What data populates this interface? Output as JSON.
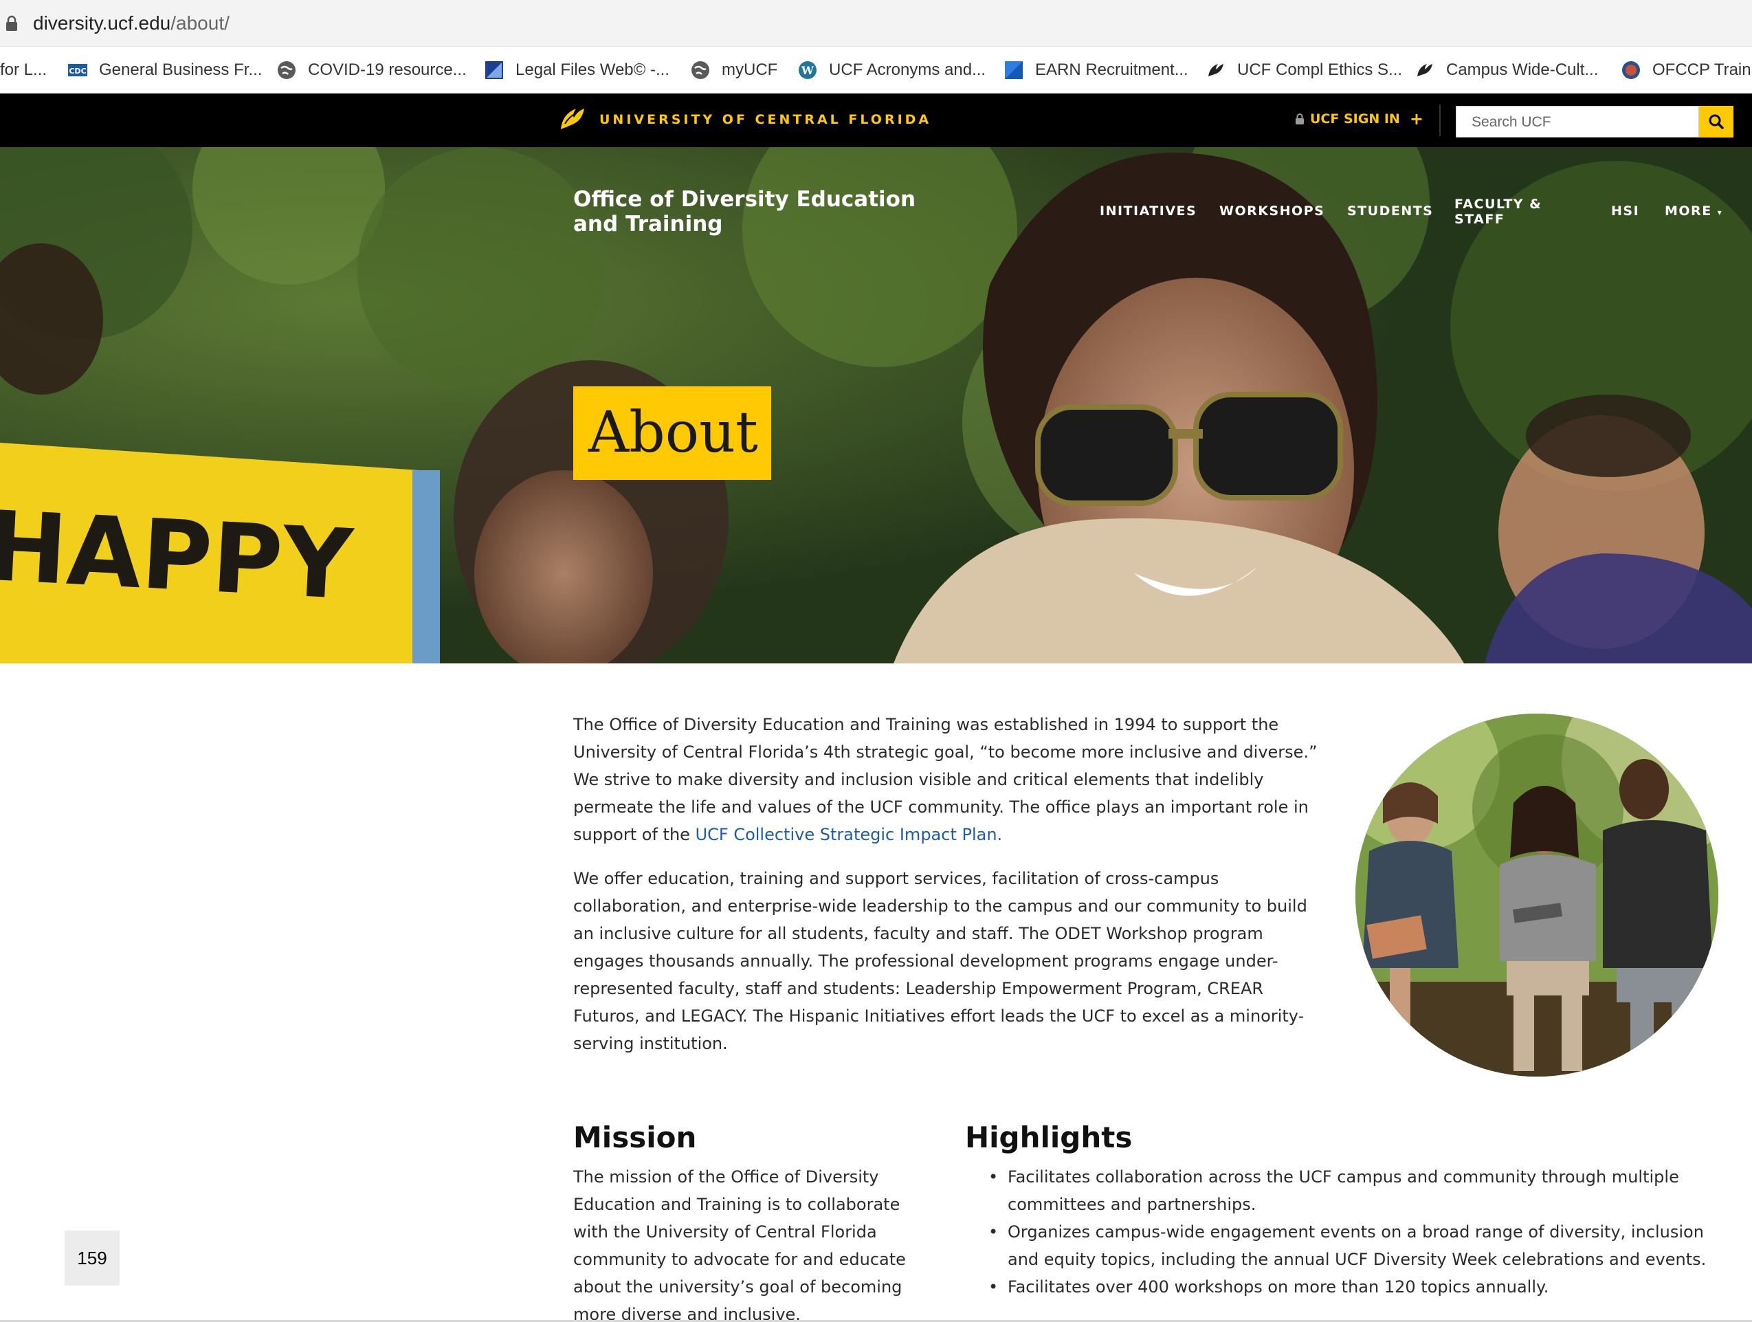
{
  "browser": {
    "url_host": "diversity.ucf.edu",
    "url_path": "/about/"
  },
  "bookmarks": [
    {
      "label": "for L...",
      "icon": "folder-icon"
    },
    {
      "label": "General Business Fr...",
      "icon": "cdc-icon"
    },
    {
      "label": "COVID-19 resource...",
      "icon": "globe-icon"
    },
    {
      "label": "Legal Files Web© -...",
      "icon": "legal-files-icon"
    },
    {
      "label": "myUCF",
      "icon": "globe-icon"
    },
    {
      "label": "UCF Acronyms and...",
      "icon": "wordpress-icon"
    },
    {
      "label": "EARN Recruitment...",
      "icon": "earn-icon"
    },
    {
      "label": "UCF Compl Ethics S...",
      "icon": "ucf-pegasus-icon"
    },
    {
      "label": "Campus Wide-Cult...",
      "icon": "ucf-pegasus-icon"
    },
    {
      "label": "OFCCP Trainin",
      "icon": "ofccp-icon"
    }
  ],
  "ucf_bar": {
    "university_name": "UNIVERSITY OF CENTRAL FLORIDA",
    "signin_prefix": "UCF",
    "signin_label": "SIGN IN",
    "signin_plus": "+",
    "search_placeholder": "Search UCF",
    "brand_color": "#ffc904"
  },
  "site": {
    "title": "Office of Diversity Education and Training",
    "nav": [
      "INITIATIVES",
      "WORKSHOPS",
      "STUDENTS",
      "FACULTY & STAFF",
      "HSI",
      "MORE"
    ],
    "more_caret": "▾"
  },
  "hero": {
    "page_heading": "About",
    "sign_text": "HAPPY"
  },
  "intro": {
    "p1_text": "The Office of Diversity Education and Training was established in 1994 to support the University of Central Florida’s 4th strategic goal, “to become more inclusive and diverse.”  We strive to make diversity and inclusion visible and critical elements that indelibly permeate the life and values of the UCF community. The office plays an important role in support of the ",
    "p1_link": "UCF Collective Strategic Impact Plan.",
    "p2_text": "We offer education, training and support services, facilitation of cross-campus collaboration, and enterprise-wide leadership to the campus and our community to build an inclusive culture for all students, faculty and staff. The ODET Workshop program engages thousands annually. The professional development programs engage under-represented faculty, staff and students: Leadership Empowerment Program, CREAR Futuros, and LEGACY. The Hispanic Initiatives effort leads the UCF to excel as a minority-serving institution."
  },
  "mission": {
    "heading": "Mission",
    "text": "The mission of the Office of Diversity Education and Training is to collaborate with the University of Central Florida community to advocate for and educate about the university’s goal of becoming more diverse and inclusive."
  },
  "highlights": {
    "heading": "Highlights",
    "items": [
      "Facilitates collaboration across the UCF campus and community through multiple committees and partnerships.",
      "Organizes campus-wide engagement events on a broad range of diversity, inclusion and equity topics, including the annual UCF Diversity Week celebrations and events.",
      "Facilitates over 400 workshops on more than 120 topics annually."
    ]
  },
  "page_number": "159"
}
